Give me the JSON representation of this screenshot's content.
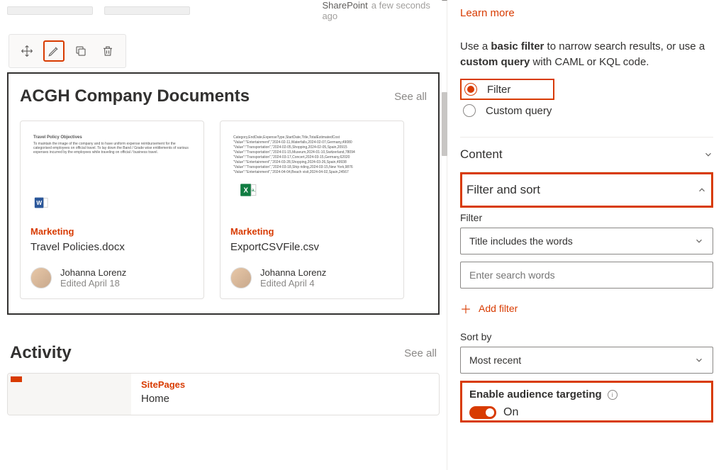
{
  "top": {
    "source": "SharePoint",
    "time": "a few seconds ago"
  },
  "webpart": {
    "title": "ACGH Company Documents",
    "see_all": "See all",
    "cards": [
      {
        "category": "Marketing",
        "title": "Travel Policies.docx",
        "author": "Johanna Lorenz",
        "edited": "Edited April 18",
        "icon": "word"
      },
      {
        "category": "Marketing",
        "title": "ExportCSVFile.csv",
        "author": "Johanna Lorenz",
        "edited": "Edited April 4",
        "icon": "excel"
      }
    ]
  },
  "activity": {
    "title": "Activity",
    "see_all": "See all",
    "item": {
      "source": "SitePages",
      "name": "Home"
    }
  },
  "panel": {
    "learn_more": "Learn more",
    "description_prefix": "Use a ",
    "description_bold1": "basic filter",
    "description_mid": " to narrow search results, or use a ",
    "description_bold2": "custom query",
    "description_suffix": " with CAML or KQL code.",
    "radio_filter": "Filter",
    "radio_custom": "Custom query",
    "section_content": "Content",
    "section_filter_sort": "Filter and sort",
    "filter_label": "Filter",
    "filter_dropdown": "Title includes the words",
    "search_placeholder": "Enter search words",
    "add_filter": "Add filter",
    "sort_label": "Sort by",
    "sort_dropdown": "Most recent",
    "audience_label": "Enable audience targeting",
    "toggle_label": "On"
  }
}
